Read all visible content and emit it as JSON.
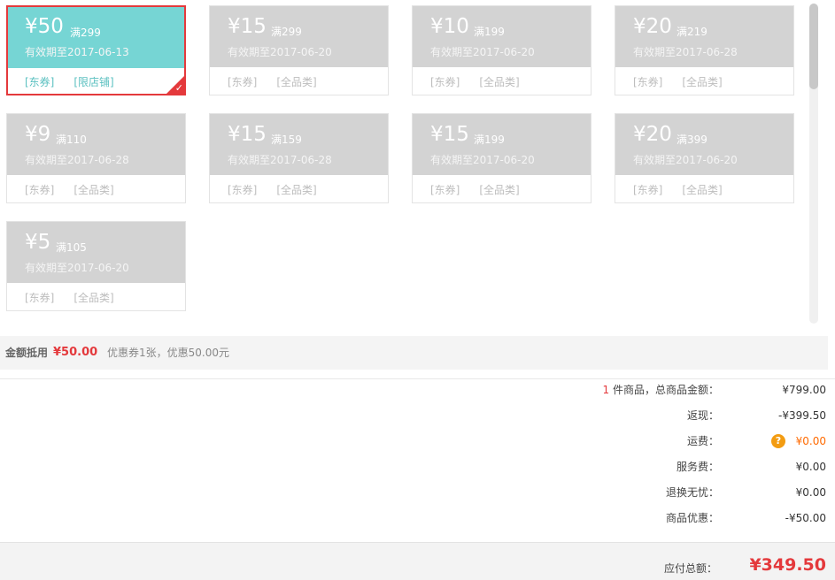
{
  "coupons": [
    {
      "amount": "¥50",
      "condition": "满299",
      "validity": "有效期至2017-06-13",
      "type": "[东券]",
      "scope": "[限店铺]"
    },
    {
      "amount": "¥15",
      "condition": "满299",
      "validity": "有效期至2017-06-20",
      "type": "[东券]",
      "scope": "[全品类]"
    },
    {
      "amount": "¥10",
      "condition": "满199",
      "validity": "有效期至2017-06-20",
      "type": "[东券]",
      "scope": "[全品类]"
    },
    {
      "amount": "¥20",
      "condition": "满219",
      "validity": "有效期至2017-06-28",
      "type": "[东券]",
      "scope": "[全品类]"
    },
    {
      "amount": "¥9",
      "condition": "满110",
      "validity": "有效期至2017-06-28",
      "type": "[东券]",
      "scope": "[全品类]"
    },
    {
      "amount": "¥15",
      "condition": "满159",
      "validity": "有效期至2017-06-28",
      "type": "[东券]",
      "scope": "[全品类]"
    },
    {
      "amount": "¥15",
      "condition": "满199",
      "validity": "有效期至2017-06-20",
      "type": "[东券]",
      "scope": "[全品类]"
    },
    {
      "amount": "¥20",
      "condition": "满399",
      "validity": "有效期至2017-06-20",
      "type": "[东券]",
      "scope": "[全品类]"
    },
    {
      "amount": "¥5",
      "condition": "满105",
      "validity": "有效期至2017-06-20",
      "type": "[东券]",
      "scope": "[全品类]"
    }
  ],
  "coupon_summary": {
    "label": "金额抵用",
    "amount": "¥50.00",
    "description": "优惠券1张，优惠50.00元"
  },
  "fees": {
    "goods": {
      "count": "1",
      "label": " 件商品，总商品金额：",
      "value": "¥799.00"
    },
    "cashback": {
      "label": "返现：",
      "value": "-¥399.50"
    },
    "shipping": {
      "label": "运费：",
      "value": "¥0.00",
      "help": "?"
    },
    "service": {
      "label": "服务费：",
      "value": "¥0.00"
    },
    "return": {
      "label": "退换无忧：",
      "value": "¥0.00"
    },
    "discount": {
      "label": "商品优惠：",
      "value": "-¥50.00"
    }
  },
  "total": {
    "label": "应付总额：",
    "value": "¥349.50"
  },
  "colors": {
    "accent": "#e4393c",
    "selected_coupon": "#76d5d4",
    "disabled_coupon": "#d3d3d3",
    "warning": "#f39c12"
  },
  "icons": {
    "check": "check-icon",
    "help": "question-icon"
  }
}
